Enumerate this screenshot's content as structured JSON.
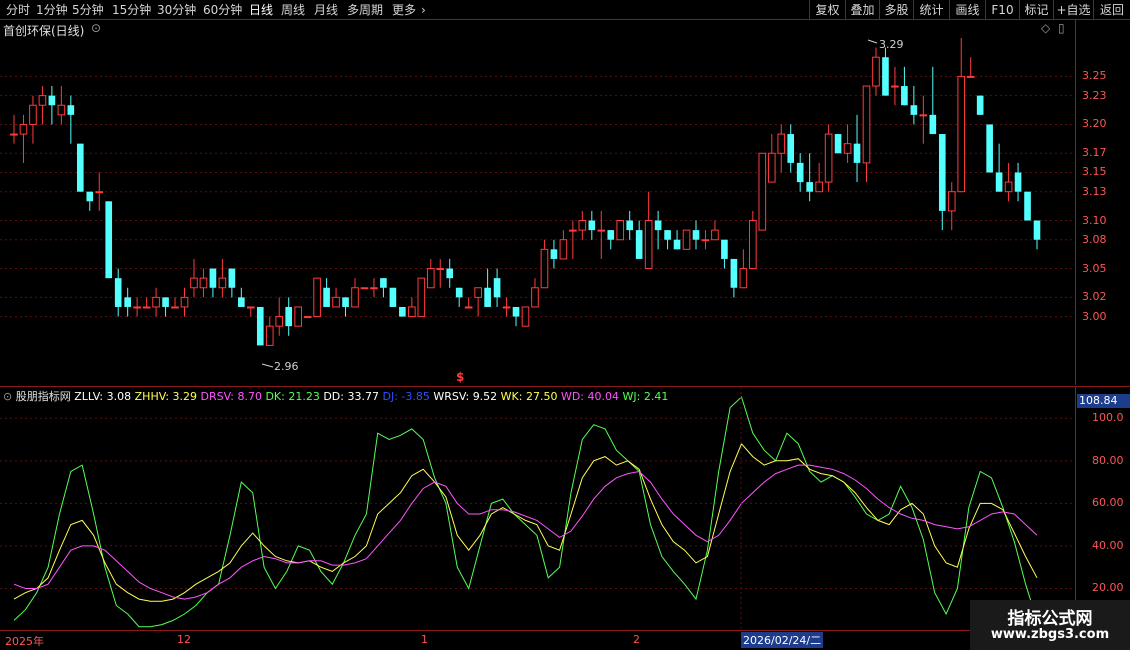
{
  "toolbar": {
    "left_items": [
      "分时",
      "1分钟",
      "5分钟",
      "15分钟",
      "30分钟",
      "60分钟",
      "日线",
      "周线",
      "月线",
      "多周期",
      "更多"
    ],
    "active_item": "日线",
    "right_items": [
      "复权",
      "叠加",
      "多股",
      "统计",
      "画线",
      "F10",
      "标记",
      "+自选",
      "返回"
    ]
  },
  "main_chart": {
    "title": "首创环保(日线)",
    "high_marker": "3.29",
    "low_marker": "2.96",
    "signal_glyph": "$",
    "y_axis_labels": [
      "3.25",
      "3.23",
      "3.20",
      "3.17",
      "3.15",
      "3.13",
      "3.10",
      "3.08",
      "3.05",
      "3.02",
      "3.00"
    ],
    "colors": {
      "up": "#ff3b3b",
      "down": "#54ffff",
      "grid": "#5a1010"
    }
  },
  "indicator": {
    "name": "股朋指标网",
    "values": [
      {
        "label": "ZLLV: 3.08",
        "color": "#ffffff"
      },
      {
        "label": "ZHHV: 3.29",
        "color": "#ffff55"
      },
      {
        "label": "DRSV: 8.70",
        "color": "#ff55ff"
      },
      {
        "label": "DK: 21.23",
        "color": "#55ff55"
      },
      {
        "label": "DD: 33.77",
        "color": "#ffffff"
      },
      {
        "label": "DJ: -3.85",
        "color": "#2e4dff"
      },
      {
        "label": "WRSV: 9.52",
        "color": "#ffffff"
      },
      {
        "label": "WK: 27.50",
        "color": "#ffff55"
      },
      {
        "label": "WD: 40.04",
        "color": "#ff55ff"
      },
      {
        "label": "WJ: 2.41",
        "color": "#55ff55"
      }
    ],
    "current_value": "108.84",
    "y_axis_labels": [
      "100.0",
      "80.00",
      "60.00",
      "40.00",
      "20.00"
    ]
  },
  "date_bar": {
    "labels": [
      "2025年",
      "12",
      "1",
      "2"
    ],
    "cursor_date": "2026/02/24/二"
  },
  "watermark": {
    "title": "指标公式网",
    "url": "www.zbgs3.com"
  },
  "chart_data": {
    "type": "candlestick",
    "candles": [
      [
        3.19,
        3.19,
        3.21,
        3.18
      ],
      [
        3.19,
        3.2,
        3.21,
        3.16
      ],
      [
        3.2,
        3.22,
        3.23,
        3.18
      ],
      [
        3.22,
        3.23,
        3.24,
        3.2
      ],
      [
        3.23,
        3.22,
        3.24,
        3.2
      ],
      [
        3.21,
        3.22,
        3.24,
        3.2
      ],
      [
        3.22,
        3.21,
        3.23,
        3.18
      ],
      [
        3.18,
        3.13,
        3.18,
        3.13
      ],
      [
        3.13,
        3.12,
        3.13,
        3.11
      ],
      [
        3.13,
        3.13,
        3.15,
        3.11
      ],
      [
        3.12,
        3.04,
        3.12,
        3.04
      ],
      [
        3.04,
        3.01,
        3.05,
        3.0
      ],
      [
        3.02,
        3.01,
        3.03,
        3.0
      ],
      [
        3.01,
        3.01,
        3.02,
        3.0
      ],
      [
        3.01,
        3.01,
        3.02,
        3.01
      ],
      [
        3.01,
        3.02,
        3.03,
        3.0
      ],
      [
        3.02,
        3.01,
        3.02,
        3.0
      ],
      [
        3.01,
        3.01,
        3.02,
        3.01
      ],
      [
        3.01,
        3.02,
        3.03,
        3.0
      ],
      [
        3.03,
        3.04,
        3.06,
        3.02
      ],
      [
        3.03,
        3.04,
        3.05,
        3.02
      ],
      [
        3.05,
        3.03,
        3.05,
        3.02
      ],
      [
        3.03,
        3.04,
        3.06,
        3.02
      ],
      [
        3.05,
        3.03,
        3.05,
        3.02
      ],
      [
        3.02,
        3.01,
        3.03,
        3.01
      ],
      [
        3.01,
        3.01,
        3.01,
        3.0
      ],
      [
        3.01,
        2.97,
        3.01,
        2.97
      ],
      [
        2.97,
        2.99,
        3.0,
        2.97
      ],
      [
        2.99,
        3.0,
        3.02,
        2.98
      ],
      [
        3.01,
        2.99,
        3.02,
        2.98
      ],
      [
        2.99,
        3.01,
        3.01,
        2.99
      ],
      [
        3.0,
        3.0,
        3.0,
        3.0
      ],
      [
        3.0,
        3.04,
        3.04,
        3.0
      ],
      [
        3.03,
        3.01,
        3.04,
        3.01
      ],
      [
        3.01,
        3.02,
        3.03,
        3.01
      ],
      [
        3.02,
        3.01,
        3.02,
        3.0
      ],
      [
        3.01,
        3.03,
        3.04,
        3.01
      ],
      [
        3.03,
        3.03,
        3.03,
        3.03
      ],
      [
        3.03,
        3.03,
        3.04,
        3.02
      ],
      [
        3.04,
        3.03,
        3.04,
        3.02
      ],
      [
        3.03,
        3.01,
        3.03,
        3.01
      ],
      [
        3.01,
        3.0,
        3.01,
        3.0
      ],
      [
        3.0,
        3.01,
        3.02,
        3.0
      ],
      [
        3.0,
        3.04,
        3.04,
        3.0
      ],
      [
        3.03,
        3.05,
        3.06,
        3.03
      ],
      [
        3.05,
        3.05,
        3.06,
        3.03
      ],
      [
        3.05,
        3.04,
        3.06,
        3.03
      ],
      [
        3.03,
        3.02,
        3.03,
        3.01
      ],
      [
        3.01,
        3.01,
        3.02,
        3.01
      ],
      [
        3.02,
        3.03,
        3.03,
        3.0
      ],
      [
        3.03,
        3.01,
        3.05,
        3.01
      ],
      [
        3.04,
        3.02,
        3.05,
        3.01
      ],
      [
        3.01,
        3.01,
        3.02,
        3.0
      ],
      [
        3.01,
        3.0,
        3.01,
        2.99
      ],
      [
        2.99,
        3.01,
        3.01,
        2.99
      ],
      [
        3.01,
        3.03,
        3.04,
        3.01
      ],
      [
        3.03,
        3.07,
        3.08,
        3.03
      ],
      [
        3.07,
        3.06,
        3.08,
        3.05
      ],
      [
        3.06,
        3.08,
        3.09,
        3.06
      ],
      [
        3.09,
        3.09,
        3.1,
        3.06
      ],
      [
        3.09,
        3.1,
        3.11,
        3.08
      ],
      [
        3.1,
        3.09,
        3.11,
        3.08
      ],
      [
        3.09,
        3.09,
        3.11,
        3.06
      ],
      [
        3.09,
        3.08,
        3.09,
        3.07
      ],
      [
        3.08,
        3.1,
        3.1,
        3.08
      ],
      [
        3.1,
        3.09,
        3.11,
        3.08
      ],
      [
        3.09,
        3.06,
        3.1,
        3.06
      ],
      [
        3.05,
        3.1,
        3.13,
        3.05
      ],
      [
        3.1,
        3.09,
        3.11,
        3.07
      ],
      [
        3.09,
        3.08,
        3.09,
        3.07
      ],
      [
        3.08,
        3.07,
        3.09,
        3.07
      ],
      [
        3.07,
        3.09,
        3.09,
        3.07
      ],
      [
        3.09,
        3.08,
        3.1,
        3.07
      ],
      [
        3.08,
        3.08,
        3.09,
        3.07
      ],
      [
        3.08,
        3.09,
        3.1,
        3.08
      ],
      [
        3.08,
        3.06,
        3.08,
        3.05
      ],
      [
        3.06,
        3.03,
        3.06,
        3.02
      ],
      [
        3.03,
        3.05,
        3.07,
        3.03
      ],
      [
        3.05,
        3.1,
        3.11,
        3.05
      ],
      [
        3.09,
        3.17,
        3.17,
        3.09
      ],
      [
        3.14,
        3.17,
        3.19,
        3.14
      ],
      [
        3.17,
        3.19,
        3.2,
        3.15
      ],
      [
        3.19,
        3.16,
        3.2,
        3.15
      ],
      [
        3.16,
        3.14,
        3.17,
        3.13
      ],
      [
        3.14,
        3.13,
        3.17,
        3.12
      ],
      [
        3.13,
        3.14,
        3.16,
        3.13
      ],
      [
        3.14,
        3.19,
        3.2,
        3.13
      ],
      [
        3.19,
        3.17,
        3.18,
        3.17
      ],
      [
        3.17,
        3.18,
        3.2,
        3.16
      ],
      [
        3.18,
        3.16,
        3.21,
        3.14
      ],
      [
        3.16,
        3.24,
        3.24,
        3.14
      ],
      [
        3.24,
        3.27,
        3.28,
        3.23
      ],
      [
        3.27,
        3.23,
        3.28,
        3.23
      ],
      [
        3.24,
        3.24,
        3.26,
        3.22
      ],
      [
        3.24,
        3.22,
        3.26,
        3.22
      ],
      [
        3.22,
        3.21,
        3.24,
        3.2
      ],
      [
        3.21,
        3.21,
        3.23,
        3.18
      ],
      [
        3.21,
        3.19,
        3.26,
        3.19
      ],
      [
        3.19,
        3.11,
        3.19,
        3.09
      ],
      [
        3.11,
        3.13,
        3.14,
        3.09
      ],
      [
        3.13,
        3.25,
        3.29,
        3.13
      ],
      [
        3.25,
        3.25,
        3.27,
        3.25
      ],
      [
        3.23,
        3.21,
        3.23,
        3.21
      ],
      [
        3.2,
        3.15,
        3.19,
        3.15
      ],
      [
        3.15,
        3.13,
        3.18,
        3.13
      ],
      [
        3.13,
        3.14,
        3.16,
        3.12
      ],
      [
        3.15,
        3.13,
        3.16,
        3.12
      ],
      [
        3.13,
        3.1,
        3.13,
        3.1
      ],
      [
        3.1,
        3.08,
        3.1,
        3.07
      ]
    ],
    "indicator_series": [
      {
        "name": "DK",
        "color": "#55ff55",
        "values": [
          5,
          10,
          18,
          30,
          55,
          75,
          78,
          55,
          30,
          12,
          8,
          2,
          2,
          3,
          5,
          8,
          12,
          18,
          22,
          45,
          70,
          65,
          30,
          20,
          28,
          40,
          38,
          28,
          22,
          32,
          45,
          55,
          93,
          90,
          92,
          95,
          90,
          72,
          60,
          30,
          20,
          40,
          60,
          62,
          55,
          50,
          45,
          25,
          30,
          65,
          90,
          97,
          95,
          85,
          80,
          75,
          50,
          35,
          28,
          22,
          15,
          38,
          75,
          105,
          110,
          93,
          85,
          80,
          93,
          88,
          75,
          70,
          73,
          70,
          63,
          55,
          52,
          55,
          68,
          58,
          43,
          18,
          8,
          20,
          58,
          75,
          72,
          58,
          42,
          22,
          5
        ]
      },
      {
        "name": "DD",
        "color": "#ffff55",
        "values": [
          15,
          18,
          20,
          25,
          38,
          50,
          52,
          45,
          32,
          22,
          18,
          15,
          14,
          14,
          15,
          18,
          22,
          25,
          28,
          32,
          40,
          46,
          40,
          35,
          33,
          32,
          33,
          30,
          28,
          32,
          35,
          40,
          55,
          60,
          65,
          73,
          76,
          70,
          63,
          45,
          38,
          45,
          55,
          58,
          55,
          52,
          50,
          40,
          38,
          55,
          72,
          80,
          82,
          78,
          80,
          76,
          62,
          50,
          42,
          38,
          32,
          35,
          55,
          75,
          88,
          82,
          78,
          80,
          80,
          81,
          76,
          74,
          73,
          70,
          65,
          58,
          52,
          50,
          57,
          60,
          55,
          40,
          32,
          30,
          48,
          60,
          60,
          57,
          46,
          35,
          25
        ]
      },
      {
        "name": "WD",
        "color": "#ff55ff",
        "values": [
          22,
          20,
          20,
          22,
          30,
          38,
          40,
          40,
          38,
          33,
          28,
          23,
          20,
          18,
          16,
          15,
          16,
          18,
          22,
          25,
          30,
          33,
          35,
          34,
          32,
          32,
          33,
          33,
          31,
          31,
          32,
          34,
          40,
          46,
          52,
          60,
          67,
          70,
          68,
          60,
          55,
          55,
          57,
          57,
          56,
          54,
          52,
          48,
          44,
          47,
          54,
          62,
          68,
          72,
          74,
          75,
          70,
          62,
          55,
          50,
          45,
          42,
          45,
          52,
          60,
          65,
          70,
          74,
          76,
          78,
          78,
          77,
          76,
          74,
          71,
          67,
          62,
          58,
          55,
          53,
          52,
          50,
          49,
          48,
          49,
          52,
          55,
          56,
          55,
          50,
          45
        ]
      }
    ],
    "ylim_price": [
      2.96,
      3.29
    ],
    "ylim_indicator": [
      0,
      110
    ]
  }
}
